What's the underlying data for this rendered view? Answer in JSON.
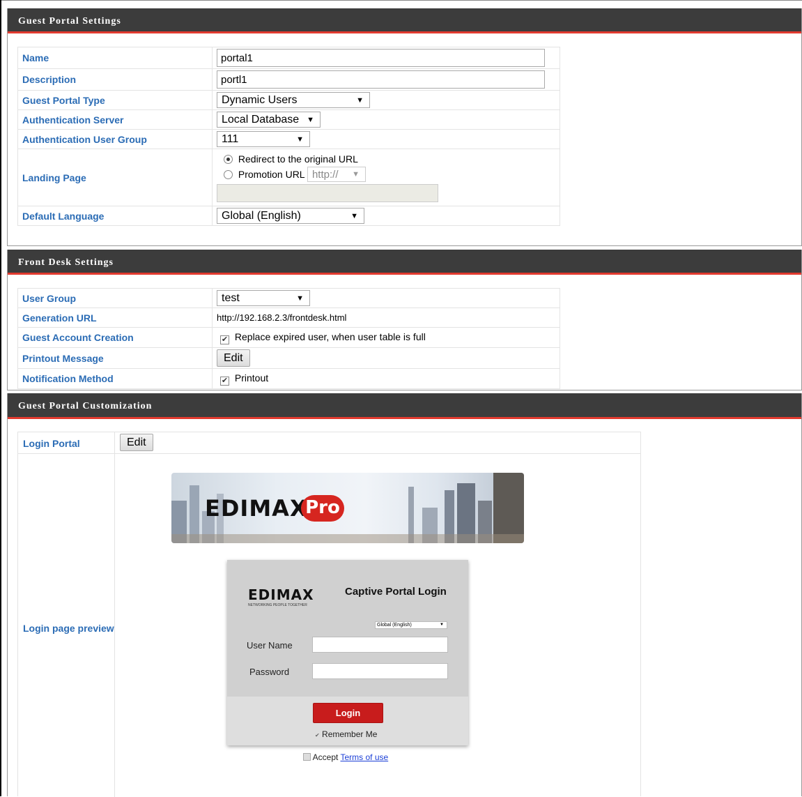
{
  "guest_portal": {
    "title": "Guest Portal Settings",
    "name_label": "Name",
    "name_value": "portal1",
    "description_label": "Description",
    "description_value": "portl1",
    "type_label": "Guest Portal Type",
    "type_value": "Dynamic Users",
    "auth_server_label": "Authentication Server",
    "auth_server_value": "Local Database",
    "auth_group_label": "Authentication User Group",
    "auth_group_value": "111",
    "landing_label": "Landing Page",
    "landing_option_redirect": "Redirect to the original URL",
    "landing_option_promotion": "Promotion URL",
    "promotion_protocol": "http://",
    "promotion_url_value": "",
    "language_label": "Default Language",
    "language_value": "Global (English)"
  },
  "front_desk": {
    "title": "Front Desk Settings",
    "user_group_label": "User Group",
    "user_group_value": "test",
    "generation_url_label": "Generation URL",
    "generation_url_value": "http://192.168.2.3/frontdesk.html",
    "guest_account_label": "Guest Account Creation",
    "guest_account_option": "Replace expired user, when user table is full",
    "printout_message_label": "Printout Message",
    "edit_label": "Edit",
    "notification_label": "Notification Method",
    "notification_option": "Printout"
  },
  "customization": {
    "title": "Guest Portal Customization",
    "login_portal_label": "Login Portal",
    "edit_label": "Edit",
    "preview_label": "Login page preview",
    "preview": {
      "banner_brand": "EDIMAX",
      "banner_pro": "Pro",
      "logo_text": "EDIMAX",
      "logo_tagline": "NETWORKING PEOPLE TOGETHER",
      "title": "Captive Portal Login",
      "language": "Global (English)",
      "username_label": "User Name",
      "password_label": "Password",
      "login_button": "Login",
      "remember_me": "Remember Me",
      "accept_text": "Accept",
      "terms_link": "Terms of use"
    }
  },
  "colors": {
    "header_bg": "#3c3c3c",
    "header_accent": "#e23a2f",
    "label_blue": "#2b6cb5",
    "login_red": "#c81c1c"
  },
  "icons": {
    "dropdown": "triangle-down",
    "checkbox_checked": "check-mark",
    "radio": "radio-circle"
  }
}
